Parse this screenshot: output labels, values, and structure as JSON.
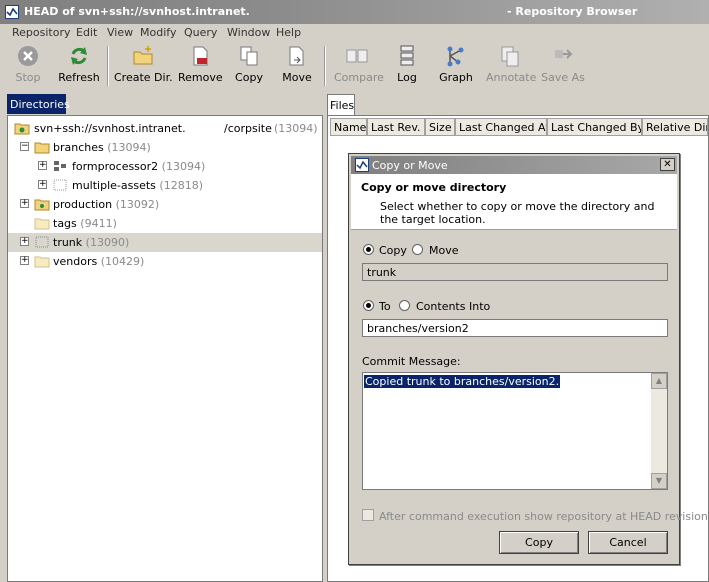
{
  "window": {
    "title_left": "HEAD of svn+ssh://svnhost.intranet.",
    "title_right": "- Repository Browser"
  },
  "menu": [
    "Repository",
    "Edit",
    "View",
    "Modify",
    "Query",
    "Window",
    "Help"
  ],
  "toolbar": [
    {
      "label": "Stop",
      "icon": "stop-icon",
      "enabled": false
    },
    {
      "label": "Refresh",
      "icon": "refresh-icon",
      "enabled": true
    },
    {
      "label": "Create Dir.",
      "icon": "create-dir-icon",
      "enabled": true
    },
    {
      "label": "Remove",
      "icon": "remove-icon",
      "enabled": true
    },
    {
      "label": "Copy",
      "icon": "copy-icon",
      "enabled": true
    },
    {
      "label": "Move",
      "icon": "move-icon",
      "enabled": true
    },
    {
      "label": "Compare",
      "icon": "compare-icon",
      "enabled": false
    },
    {
      "label": "Log",
      "icon": "log-icon",
      "enabled": true
    },
    {
      "label": "Graph",
      "icon": "graph-icon",
      "enabled": true
    },
    {
      "label": "Annotate",
      "icon": "annotate-icon",
      "enabled": false
    },
    {
      "label": "Save As",
      "icon": "save-as-icon",
      "enabled": false
    }
  ],
  "left_tab": "Directories",
  "tree": {
    "root": {
      "name": "svn+ssh://svnhost.intranet.",
      "suffix": "/corpsite",
      "rev": "(13094)"
    },
    "items": [
      {
        "name": "branches",
        "rev": "(13094)",
        "expanded": true
      },
      {
        "name": "formprocessor2",
        "rev": "(13094)"
      },
      {
        "name": "multiple-assets",
        "rev": "(12818)"
      },
      {
        "name": "production",
        "rev": "(13092)"
      },
      {
        "name": "tags",
        "rev": "(9411)"
      },
      {
        "name": "trunk",
        "rev": "(13090)"
      },
      {
        "name": "vendors",
        "rev": "(10429)"
      }
    ]
  },
  "right_tab": "Files",
  "columns": [
    "Name",
    "Last Rev.",
    "Size",
    "Last Changed At",
    "Last Changed By",
    "Relative Dire"
  ],
  "dialog": {
    "title": "Copy or Move",
    "heading": "Copy or move directory",
    "description": "Select whether to copy or move the directory and the target location.",
    "op_copy": "Copy",
    "op_move": "Move",
    "source": "trunk",
    "target_to": "To",
    "target_into": "Contents Into",
    "target": "branches/version2",
    "commit_label": "Commit Message:",
    "commit_message": "Copied trunk to branches/version2.",
    "after_label": "After command execution show repository at HEAD revision",
    "copy_button": "Copy",
    "cancel_button": "Cancel"
  },
  "colors": {
    "selection": "#0a246a",
    "titlebar": "#808080",
    "disabled_text": "#8a8a8a",
    "folder": "#f2d27a"
  }
}
